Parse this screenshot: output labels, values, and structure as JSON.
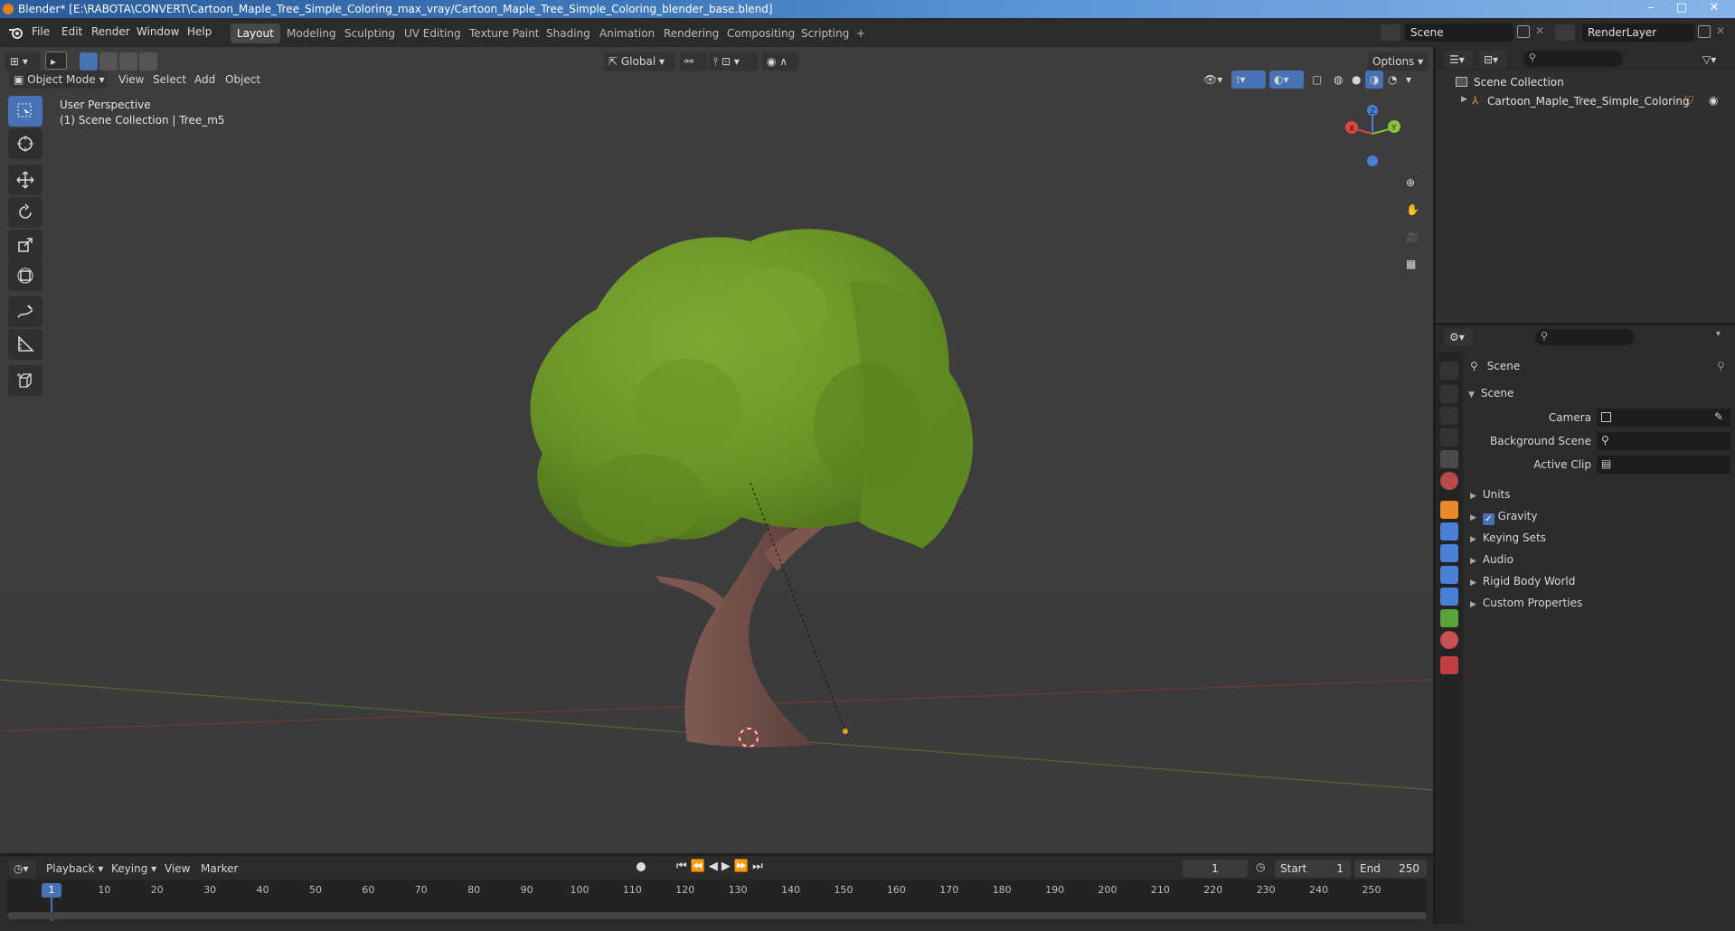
{
  "window": {
    "title": "Blender* [E:\\RABOTA\\CONVERT\\Cartoon_Maple_Tree_Simple_Coloring_max_vray/Cartoon_Maple_Tree_Simple_Coloring_blender_base.blend]",
    "minimize": "–",
    "maximize": "□",
    "close": "✕"
  },
  "menu": [
    "File",
    "Edit",
    "Render",
    "Window",
    "Help"
  ],
  "workspaces": [
    "Layout",
    "Modeling",
    "Sculpting",
    "UV Editing",
    "Texture Paint",
    "Shading",
    "Animation",
    "Rendering",
    "Compositing",
    "Scripting"
  ],
  "workspace_add": "+",
  "scene_field": "Scene",
  "render_layer_field": "RenderLayer",
  "viewport": {
    "header": {
      "transform_orientation": "Global",
      "options": "Options",
      "mode": "Object Mode",
      "menus": [
        "View",
        "Select",
        "Add",
        "Object"
      ]
    },
    "overlay_text": {
      "perspective": "User Perspective",
      "collection": "(1) Scene Collection | Tree_m5"
    },
    "gizmo": {
      "x": "X",
      "y": "Y",
      "z": "Z"
    },
    "colors": {
      "foliage": "#6f9a2a",
      "trunk": "#6b4a44",
      "background": "#3d3d3d"
    }
  },
  "outliner": {
    "root": "Scene Collection",
    "items": [
      "Cartoon_Maple_Tree_Simple_Coloring"
    ]
  },
  "properties": {
    "breadcrumb": "Scene",
    "panel_title": "Scene",
    "fields": [
      {
        "label": "Camera",
        "value": ""
      },
      {
        "label": "Background Scene",
        "value": ""
      },
      {
        "label": "Active Clip",
        "value": ""
      }
    ],
    "subpanels": [
      "Units",
      "Gravity",
      "Keying Sets",
      "Audio",
      "Rigid Body World",
      "Custom Properties"
    ],
    "gravity_checked": true
  },
  "timeline": {
    "menus": [
      "Playback",
      "Keying",
      "View",
      "Marker"
    ],
    "current_frame": "1",
    "start_label": "Start",
    "start": "1",
    "end_label": "End",
    "end": "250",
    "ticks": [
      "1",
      "10",
      "20",
      "30",
      "40",
      "50",
      "60",
      "70",
      "80",
      "90",
      "100",
      "110",
      "120",
      "130",
      "140",
      "150",
      "160",
      "170",
      "180",
      "190",
      "200",
      "210",
      "220",
      "230",
      "240",
      "250"
    ]
  }
}
